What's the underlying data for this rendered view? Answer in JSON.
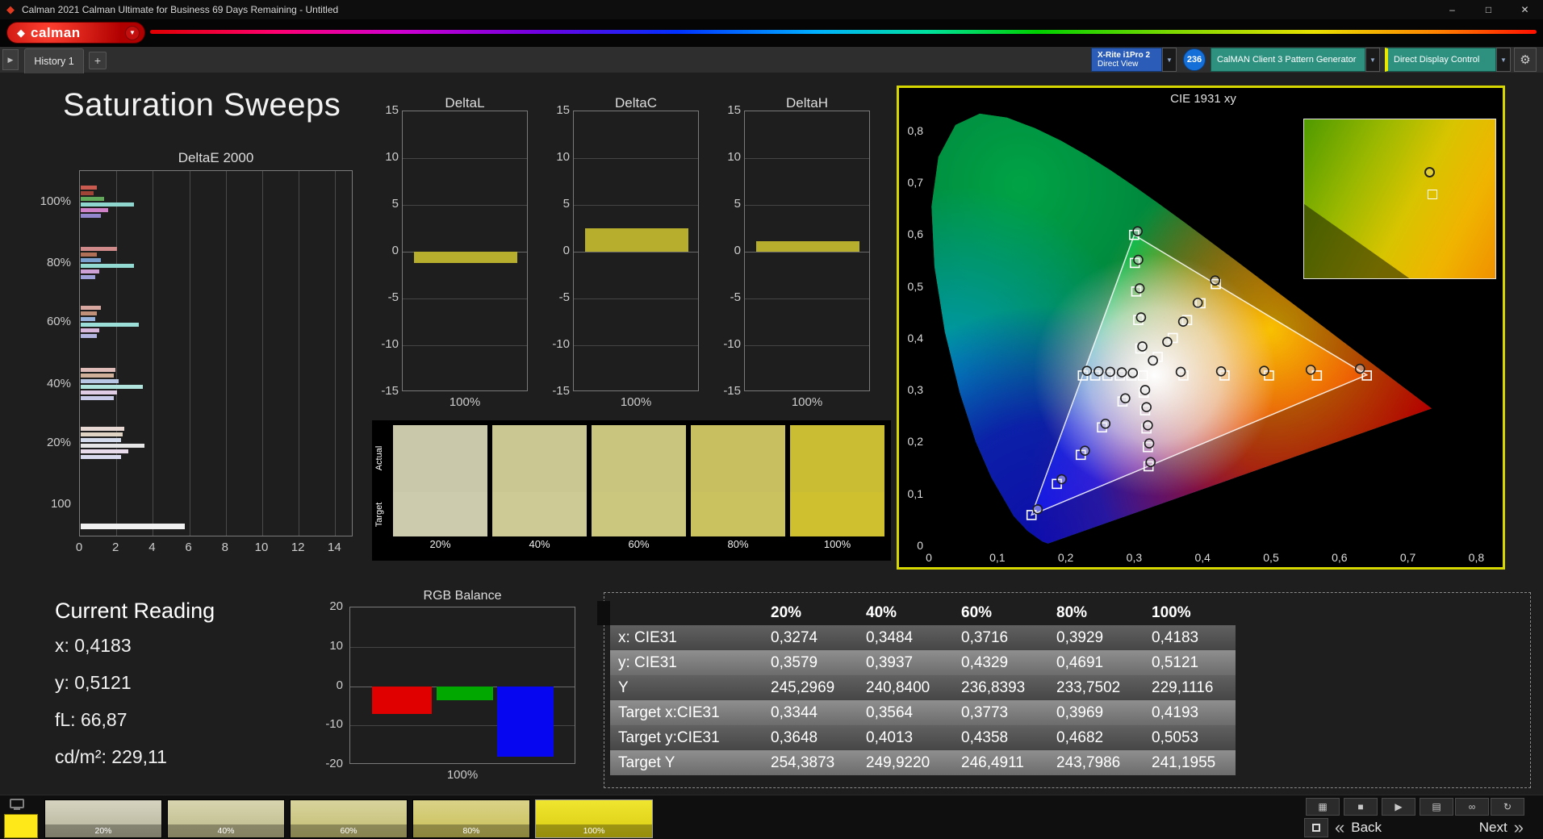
{
  "window": {
    "title": "Calman 2021 Calman Ultimate for Business 69 Days Remaining  - Untitled"
  },
  "icons": {
    "minimize": "–",
    "maximize": "□",
    "close": "✕",
    "caret_down": "▼",
    "gear": "⚙",
    "play": "▶",
    "logo_mark": "◆"
  },
  "brand": {
    "logo": "calman"
  },
  "nav": {
    "tab": "History 1",
    "add_tab": "+"
  },
  "devices": {
    "meter": {
      "line1": "X-Rite i1Pro 2",
      "line2": "Direct View"
    },
    "badge": "236",
    "pattern_generator": "CalMAN Client 3 Pattern Generator",
    "display_control": "Direct Display Control"
  },
  "page": {
    "title": "Saturation Sweeps"
  },
  "chart_data": {
    "deltae2000": {
      "type": "bar",
      "orientation": "horizontal",
      "title": "DeltaE 2000",
      "xlim": [
        0,
        15
      ],
      "x_ticks": [
        0,
        2,
        4,
        6,
        8,
        10,
        12,
        14
      ],
      "groups": [
        {
          "label": "100%",
          "bars": [
            {
              "c": "#c85a50",
              "v": 0.9
            },
            {
              "c": "#a04438",
              "v": 0.7
            },
            {
              "c": "#62a85a",
              "v": 1.3
            },
            {
              "c": "#8ed6ce",
              "v": 2.9
            },
            {
              "c": "#d083c8",
              "v": 1.5
            },
            {
              "c": "#9486cc",
              "v": 1.1
            }
          ]
        },
        {
          "label": "80%",
          "bars": [
            {
              "c": "#d08a8a",
              "v": 2.0
            },
            {
              "c": "#b07058",
              "v": 0.9
            },
            {
              "c": "#7aa0d0",
              "v": 1.1
            },
            {
              "c": "#93dad2",
              "v": 2.9
            },
            {
              "c": "#cda0d6",
              "v": 1.0
            },
            {
              "c": "#a0a0d8",
              "v": 0.8
            }
          ]
        },
        {
          "label": "60%",
          "bars": [
            {
              "c": "#d8a8a0",
              "v": 1.1
            },
            {
              "c": "#c09078",
              "v": 0.9
            },
            {
              "c": "#98b4dc",
              "v": 0.8
            },
            {
              "c": "#9cdfd8",
              "v": 3.2
            },
            {
              "c": "#d8b8dc",
              "v": 1.0
            },
            {
              "c": "#b4b4e0",
              "v": 0.9
            }
          ]
        },
        {
          "label": "40%",
          "bars": [
            {
              "c": "#e0bcb8",
              "v": 1.9
            },
            {
              "c": "#d0b098",
              "v": 1.8
            },
            {
              "c": "#b8c8e4",
              "v": 2.1
            },
            {
              "c": "#b2e4de",
              "v": 3.4
            },
            {
              "c": "#e0cce4",
              "v": 2.0
            },
            {
              "c": "#c8c8e8",
              "v": 1.8
            }
          ]
        },
        {
          "label": "20%",
          "bars": [
            {
              "c": "#e8d8d4",
              "v": 2.4
            },
            {
              "c": "#e0d4c4",
              "v": 2.3
            },
            {
              "c": "#d4dcec",
              "v": 2.2
            },
            {
              "c": "#e6e6e6",
              "v": 3.5
            },
            {
              "c": "#e8dcec",
              "v": 2.6
            },
            {
              "c": "#d8d8ee",
              "v": 2.2
            }
          ]
        }
      ],
      "total_bar": {
        "label": "100",
        "c": "#f0f0f0",
        "v": 5.7
      }
    },
    "deltaL": {
      "type": "bar",
      "title": "DeltaL",
      "ylim": [
        -15,
        15
      ],
      "y_ticks": [
        15,
        10,
        5,
        0,
        -5,
        -10,
        -15
      ],
      "x_label": "100%",
      "value": -1.2,
      "color": "#b7ae2e"
    },
    "deltaC": {
      "type": "bar",
      "title": "DeltaC",
      "ylim": [
        -15,
        15
      ],
      "y_ticks": [
        15,
        10,
        5,
        0,
        -5,
        -10,
        -15
      ],
      "x_label": "100%",
      "value": 2.5,
      "color": "#b7ae2e"
    },
    "deltaH": {
      "type": "bar",
      "title": "DeltaH",
      "ylim": [
        -15,
        15
      ],
      "y_ticks": [
        15,
        10,
        5,
        0,
        -5,
        -10,
        -15
      ],
      "x_label": "100%",
      "value": 1.1,
      "color": "#b7ae2e"
    },
    "rgb_balance": {
      "type": "bar",
      "title": "RGB Balance",
      "ylim": [
        -20,
        20
      ],
      "y_ticks": [
        20,
        10,
        0,
        -10,
        -20
      ],
      "x_label": "100%",
      "series": [
        {
          "name": "Red",
          "value": -7,
          "color": "#e00000"
        },
        {
          "name": "Green",
          "value": -3.5,
          "color": "#00a800"
        },
        {
          "name": "Blue",
          "value": -18,
          "color": "#0606f0"
        }
      ]
    },
    "cie": {
      "type": "scatter",
      "title": "CIE 1931 xy",
      "xlim": [
        0,
        0.8
      ],
      "ylim": [
        0,
        0.8
      ],
      "x_ticks": [
        "0",
        "0,1",
        "0,2",
        "0,3",
        "0,4",
        "0,5",
        "0,6",
        "0,7",
        "0,8"
      ],
      "y_ticks": [
        "0",
        "0,1",
        "0,2",
        "0,3",
        "0,4",
        "0,5",
        "0,6",
        "0,7",
        "0,8"
      ],
      "gamut_triangle": [
        [
          0.64,
          0.33
        ],
        [
          0.3,
          0.6
        ],
        [
          0.15,
          0.06
        ]
      ],
      "targets": [
        [
          0.3127,
          0.329
        ],
        [
          0.372,
          0.329
        ],
        [
          0.432,
          0.329
        ],
        [
          0.497,
          0.329
        ],
        [
          0.567,
          0.329
        ],
        [
          0.64,
          0.329
        ],
        [
          0.309,
          0.381
        ],
        [
          0.306,
          0.436
        ],
        [
          0.303,
          0.491
        ],
        [
          0.301,
          0.546
        ],
        [
          0.3,
          0.6
        ],
        [
          0.283,
          0.279
        ],
        [
          0.253,
          0.229
        ],
        [
          0.222,
          0.176
        ],
        [
          0.187,
          0.12
        ],
        [
          0.15,
          0.06
        ],
        [
          0.296,
          0.329
        ],
        [
          0.279,
          0.329
        ],
        [
          0.261,
          0.329
        ],
        [
          0.243,
          0.329
        ],
        [
          0.225,
          0.329
        ],
        [
          0.314,
          0.296
        ],
        [
          0.316,
          0.262
        ],
        [
          0.318,
          0.227
        ],
        [
          0.32,
          0.191
        ],
        [
          0.321,
          0.154
        ],
        [
          0.3344,
          0.3648
        ],
        [
          0.3564,
          0.4013
        ],
        [
          0.3773,
          0.4358
        ],
        [
          0.3969,
          0.4682
        ],
        [
          0.4193,
          0.5053
        ]
      ],
      "measured": [
        [
          0.3274,
          0.3579
        ],
        [
          0.3484,
          0.3937
        ],
        [
          0.3716,
          0.4329
        ],
        [
          0.3929,
          0.4691
        ],
        [
          0.4183,
          0.5121
        ],
        [
          0.368,
          0.336
        ],
        [
          0.427,
          0.337
        ],
        [
          0.49,
          0.338
        ],
        [
          0.558,
          0.34
        ],
        [
          0.63,
          0.342
        ],
        [
          0.312,
          0.385
        ],
        [
          0.31,
          0.441
        ],
        [
          0.308,
          0.497
        ],
        [
          0.306,
          0.552
        ],
        [
          0.305,
          0.607
        ],
        [
          0.287,
          0.285
        ],
        [
          0.258,
          0.236
        ],
        [
          0.228,
          0.184
        ],
        [
          0.194,
          0.129
        ],
        [
          0.159,
          0.071
        ],
        [
          0.298,
          0.334
        ],
        [
          0.282,
          0.335
        ],
        [
          0.265,
          0.336
        ],
        [
          0.248,
          0.337
        ],
        [
          0.231,
          0.338
        ],
        [
          0.316,
          0.301
        ],
        [
          0.318,
          0.268
        ],
        [
          0.32,
          0.233
        ],
        [
          0.322,
          0.198
        ],
        [
          0.324,
          0.162
        ]
      ],
      "inset": {
        "circle": [
          0.63,
          0.3
        ],
        "square": [
          0.645,
          0.44
        ]
      }
    }
  },
  "swatch_strip": {
    "row_labels": [
      "Actual",
      "Target"
    ],
    "columns": [
      {
        "label": "20%",
        "actual": "#c9c8ab",
        "target": "#cccbad"
      },
      {
        "label": "40%",
        "actual": "#cac793",
        "target": "#cdca96"
      },
      {
        "label": "60%",
        "actual": "#c9c47e",
        "target": "#ccc77f"
      },
      {
        "label": "80%",
        "actual": "#c7bf60",
        "target": "#cac25f"
      },
      {
        "label": "100%",
        "actual": "#cabc33",
        "target": "#cec02e"
      }
    ]
  },
  "current_reading": {
    "title": "Current Reading",
    "lines": [
      "x: 0,4183",
      "y: 0,5121",
      "fL: 66,87",
      "cd/m²: 229,11"
    ]
  },
  "results_table": {
    "headers": [
      "20%",
      "40%",
      "60%",
      "80%",
      "100%"
    ],
    "rows": [
      {
        "label": "x: CIE31",
        "values": [
          "0,3274",
          "0,3484",
          "0,3716",
          "0,3929",
          "0,4183"
        ]
      },
      {
        "label": "y: CIE31",
        "values": [
          "0,3579",
          "0,3937",
          "0,4329",
          "0,4691",
          "0,5121"
        ]
      },
      {
        "label": "Y",
        "values": [
          "245,2969",
          "240,8400",
          "236,8393",
          "233,7502",
          "229,1116"
        ]
      },
      {
        "label": "Target x:CIE31",
        "values": [
          "0,3344",
          "0,3564",
          "0,3773",
          "0,3969",
          "0,4193"
        ]
      },
      {
        "label": "Target y:CIE31",
        "values": [
          "0,3648",
          "0,4013",
          "0,4358",
          "0,4682",
          "0,5053"
        ]
      },
      {
        "label": "Target Y",
        "values": [
          "254,3873",
          "249,9220",
          "246,4911",
          "243,7986",
          "241,1955"
        ]
      }
    ]
  },
  "footer": {
    "current_color": "#ffe81a",
    "swatches": [
      {
        "label": "20%",
        "top": "#d6d4c0",
        "bottom": "#b4b298",
        "active": false
      },
      {
        "label": "40%",
        "top": "#d8d5af",
        "bottom": "#bcb98a",
        "active": false
      },
      {
        "label": "60%",
        "top": "#d8d39c",
        "bottom": "#c3bd72",
        "active": false
      },
      {
        "label": "80%",
        "top": "#dad288",
        "bottom": "#c9c057",
        "active": false
      },
      {
        "label": "100%",
        "top": "#f0e52f",
        "bottom": "#d9cc12",
        "active": true
      }
    ],
    "tool_icons": [
      {
        "name": "screen-icon",
        "glyph": "▦"
      },
      {
        "name": "stop-icon",
        "glyph": "■"
      },
      {
        "name": "play-icon",
        "glyph": "▶"
      },
      {
        "name": "report-icon",
        "glyph": "▤"
      },
      {
        "name": "link-icon",
        "glyph": "∞"
      },
      {
        "name": "refresh-icon",
        "glyph": "↻"
      }
    ],
    "back": "Back",
    "next": "Next"
  }
}
